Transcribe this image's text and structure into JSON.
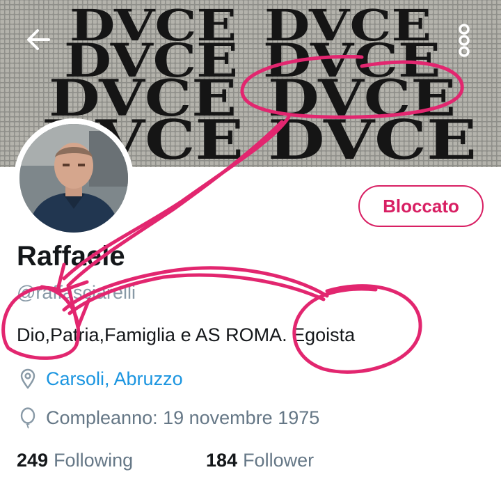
{
  "header": {
    "back_icon": "arrow-left-icon",
    "more_icon": "more-vertical-icon",
    "banner_word": "DVCE"
  },
  "profile": {
    "display_name": "Raffaele",
    "handle": "@raffasciarelli",
    "block_label": "Bloccato",
    "bio": "Dio,Patria,Famiglia e AS ROMA. Egoista",
    "location": "Carsoli, Abruzzo",
    "birthday": "Compleanno: 19 novembre 1975",
    "following_count": "249",
    "following_label": "Following",
    "followers_count": "184",
    "followers_label": "Follower"
  },
  "colors": {
    "accent": "#d81f63",
    "link": "#1b95e0",
    "annotation": "#e2266f",
    "muted": "#657786"
  }
}
